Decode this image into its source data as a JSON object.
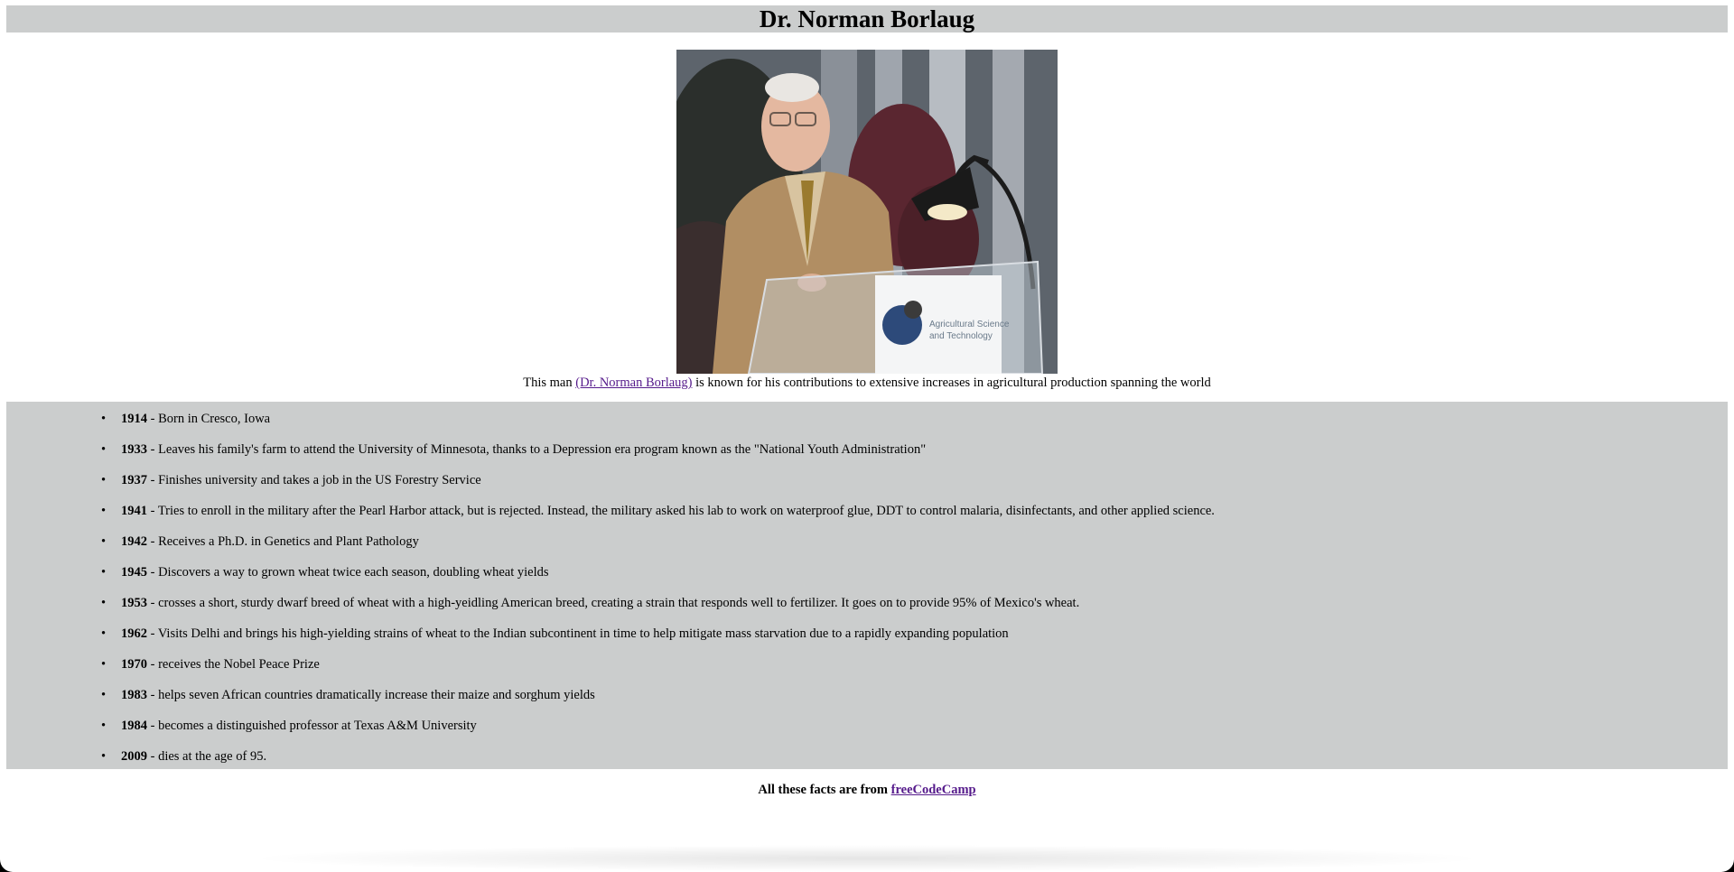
{
  "header": {
    "title": "Dr. Norman Borlaug"
  },
  "image": {
    "podium_text_line1": "Agricultural Science",
    "podium_text_line2": "and Technology"
  },
  "caption": {
    "prefix": "This man ",
    "link_text": "(Dr. Norman Borlaug)",
    "suffix": " is known for his contributions to extensive increases in agricultural production spanning the world"
  },
  "timeline": [
    {
      "year": "1914",
      "text": " - Born in Cresco, Iowa"
    },
    {
      "year": "1933",
      "text": " - Leaves his family's farm to attend the University of Minnesota, thanks to a Depression era program known as the \"National Youth Administration\""
    },
    {
      "year": "1937",
      "text": " - Finishes university and takes a job in the US Forestry Service"
    },
    {
      "year": "1941",
      "text": " - Tries to enroll in the military after the Pearl Harbor attack, but is rejected. Instead, the military asked his lab to work on waterproof glue, DDT to control malaria, disinfectants, and other applied science."
    },
    {
      "year": "1942",
      "text": " - Receives a Ph.D. in Genetics and Plant Pathology"
    },
    {
      "year": "1945",
      "text": " - Discovers a way to grown wheat twice each season, doubling wheat yields"
    },
    {
      "year": "1953",
      "text": " - crosses a short, sturdy dwarf breed of wheat with a high-yeidling American breed, creating a strain that responds well to fertilizer. It goes on to provide 95% of Mexico's wheat."
    },
    {
      "year": "1962",
      "text": " - Visits Delhi and brings his high-yielding strains of wheat to the Indian subcontinent in time to help mitigate mass starvation due to a rapidly expanding population"
    },
    {
      "year": "1970",
      "text": " - receives the Nobel Peace Prize"
    },
    {
      "year": "1983",
      "text": " - helps seven African countries dramatically increase their maize and sorghum yields"
    },
    {
      "year": "1984",
      "text": " - becomes a distinguished professor at Texas A&M University"
    },
    {
      "year": "2009",
      "text": " - dies at the age of 95."
    }
  ],
  "footer": {
    "prefix": "All these facts are from ",
    "link_text": "freeCodeCamp"
  },
  "colors": {
    "band_gray": "#cbcdcd",
    "visited_link": "#551a8b"
  }
}
